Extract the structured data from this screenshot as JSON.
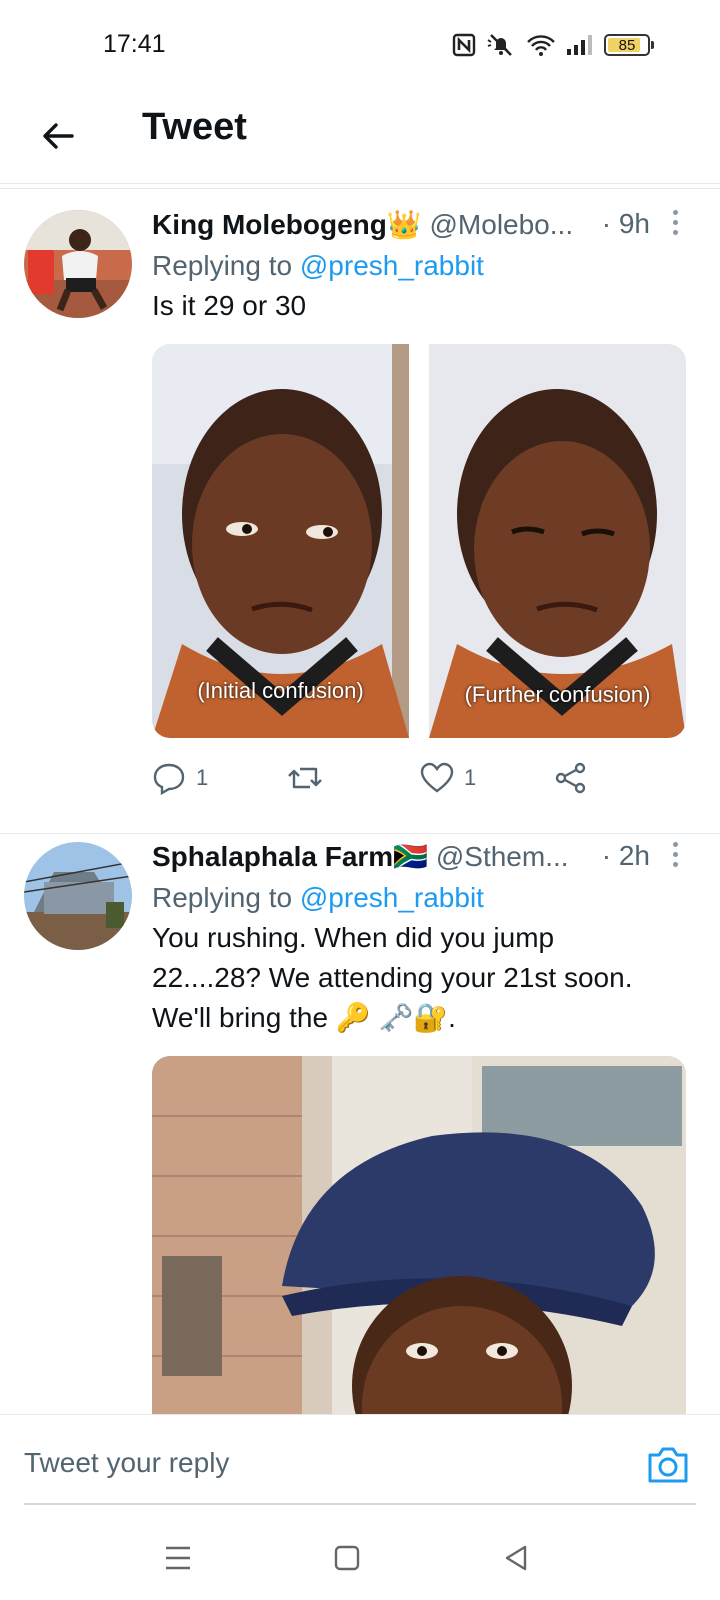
{
  "status_bar": {
    "time": "17:41",
    "battery": "85",
    "battery_level_percent": 85,
    "icons": [
      "nfc-icon",
      "mute-icon",
      "wifi-icon",
      "signal-icon",
      "battery-icon"
    ]
  },
  "header": {
    "title": "Tweet",
    "back_icon": "arrow-left-icon"
  },
  "tweets": [
    {
      "display_name": "King Molebogeng👑",
      "handle": "@Molebo...",
      "time": "· 9h",
      "replying_prefix": "Replying to ",
      "replying_to": "@presh_rabbit",
      "text": "Is it 29 or 30",
      "media": {
        "left_caption": "(Initial confusion)",
        "right_caption": "(Further confusion)"
      },
      "replies": "1",
      "likes": "1"
    },
    {
      "display_name": "Sphalaphala Farm🇿🇦",
      "handle": "@Sthem...",
      "time": "· 2h",
      "replying_prefix": "Replying to ",
      "replying_to": "@presh_rabbit",
      "text_line1": "You rushing. When did you jump",
      "text_line2": "22....28? We attending your 21st soon.",
      "text_line3": "We'll bring the 🔑 🗝️🔐."
    }
  ],
  "reply_bar": {
    "placeholder": "Tweet your reply",
    "icon": "camera-icon"
  },
  "nav_bar": {
    "icons": [
      "menu-icon",
      "home-square-icon",
      "back-triangle-icon"
    ]
  },
  "colors": {
    "accent": "#1d9bf0",
    "text": "#0f1419",
    "muted": "#536471",
    "divider": "#e6e9eb"
  }
}
